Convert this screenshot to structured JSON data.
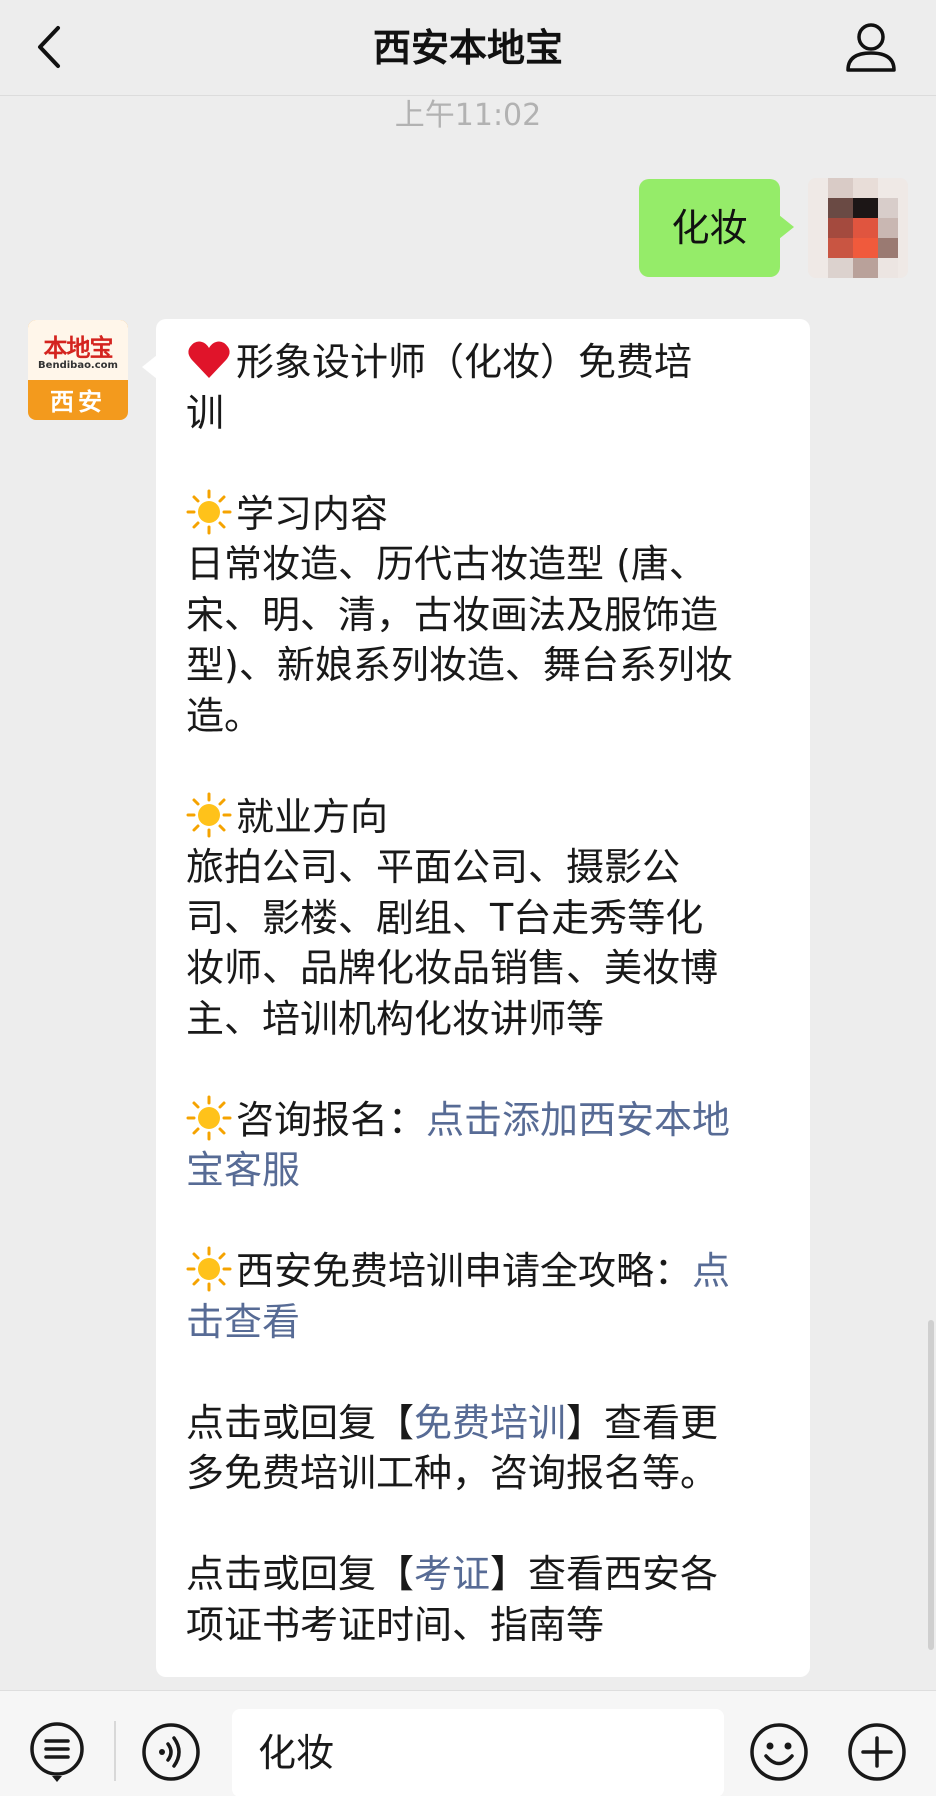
{
  "header": {
    "title": "西安本地宝",
    "back_icon": "chevron-left-icon",
    "profile_icon": "person-icon"
  },
  "timestamp": "上午11:02",
  "outgoing": {
    "text": "化妆"
  },
  "bot_avatar": {
    "brand": "本地宝",
    "domain": "Bendibao.com",
    "city": "西安"
  },
  "message": {
    "line1a": "形象设计师（化妆）免费培",
    "line1b": "训",
    "sec1_title": "学习内容",
    "sec1_lines": [
      "日常妆造、历代古妆造型 (唐、",
      "宋、明、清，古妆画法及服饰造",
      "型)、新娘系列妆造、舞台系列妆",
      "造。"
    ],
    "sec2_title": "就业方向",
    "sec2_lines": [
      "旅拍公司、平面公司、摄影公",
      "司、影楼、剧组、T台走秀等化",
      "妆师、品牌化妆品销售、美妆博",
      "主、培训机构化妆讲师等"
    ],
    "sec3_label": "咨询报名：",
    "sec3_link_a": "点击添加西安本地",
    "sec3_link_b": "宝客服",
    "sec4_label": "西安免费培训申请全攻略：",
    "sec4_link_a": "点",
    "sec4_link_b": "击查看",
    "p5_pre": "点击或回复【",
    "p5_link": "免费培训",
    "p5_post": "】查看更",
    "p5_line2": "多免费培训工种，咨询报名等。",
    "p6_pre": "点击或回复【",
    "p6_link": "考证",
    "p6_post": "】查看西安各",
    "p6_line2": "项证书考证时间、指南等"
  },
  "input_bar": {
    "menu_icon": "menu-list-icon",
    "voice_icon": "voice-icon",
    "input_value": "化妆",
    "emoji_icon": "emoji-icon",
    "plus_icon": "plus-icon"
  },
  "colors": {
    "background": "#ededed",
    "outgoing_bubble": "#95ec69",
    "link": "#576b95",
    "timestamp": "#b2b2b2"
  }
}
